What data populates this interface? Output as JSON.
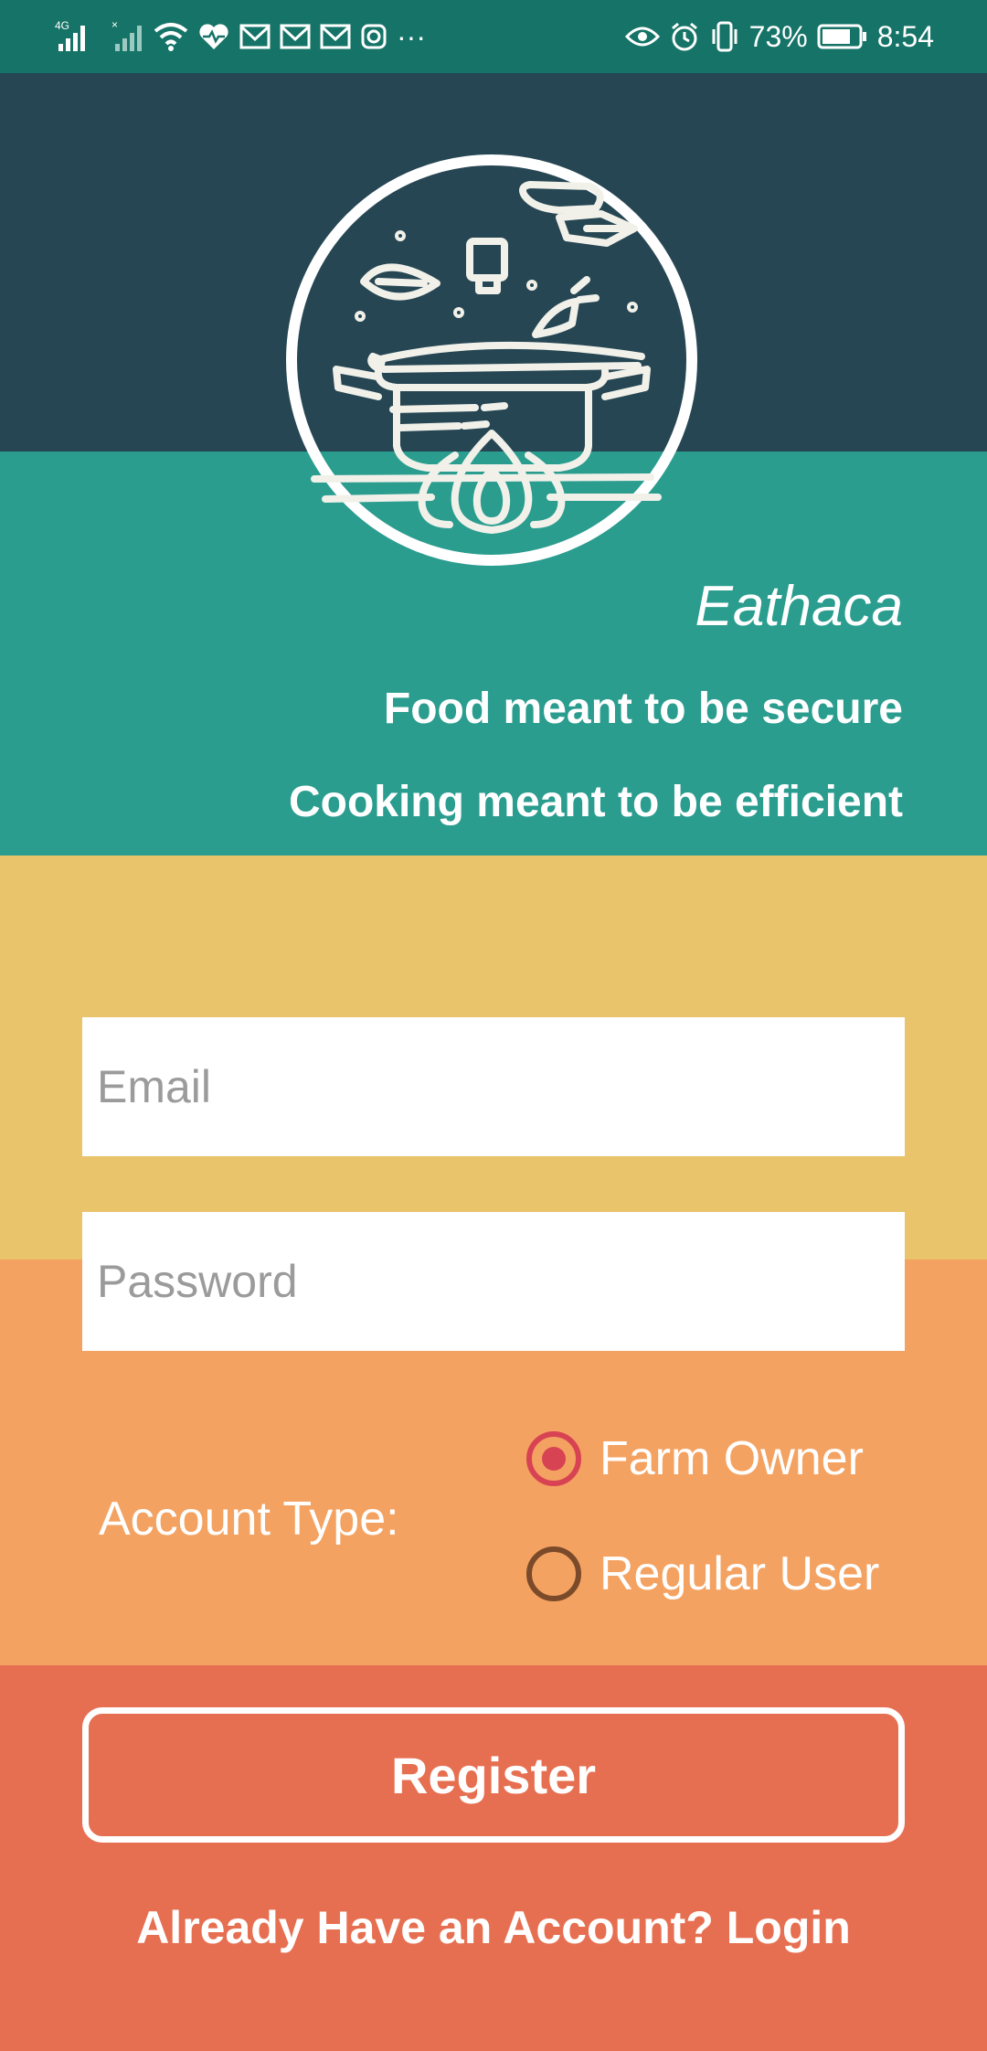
{
  "statusbar": {
    "network": "4G",
    "battery": "73%",
    "time": "8:54",
    "more": "···"
  },
  "app": {
    "name": "Eathaca",
    "tagline1": "Food meant to be secure",
    "tagline2": "Cooking meant to be efficient"
  },
  "form": {
    "email_placeholder": "Email",
    "password_placeholder": "Password",
    "account_type_label": "Account Type:",
    "options": [
      {
        "label": "Farm Owner",
        "selected": true
      },
      {
        "label": "Regular User",
        "selected": false
      }
    ],
    "register_label": "Register",
    "login_link": "Already Have an Account? Login"
  },
  "colors": {
    "statusbar": "#157367",
    "dark": "#264653",
    "teal": "#2a9d8f",
    "yellow": "#e9c46a",
    "orange": "#f4a261",
    "red": "#e76f51",
    "radio_selected": "#d84354"
  }
}
